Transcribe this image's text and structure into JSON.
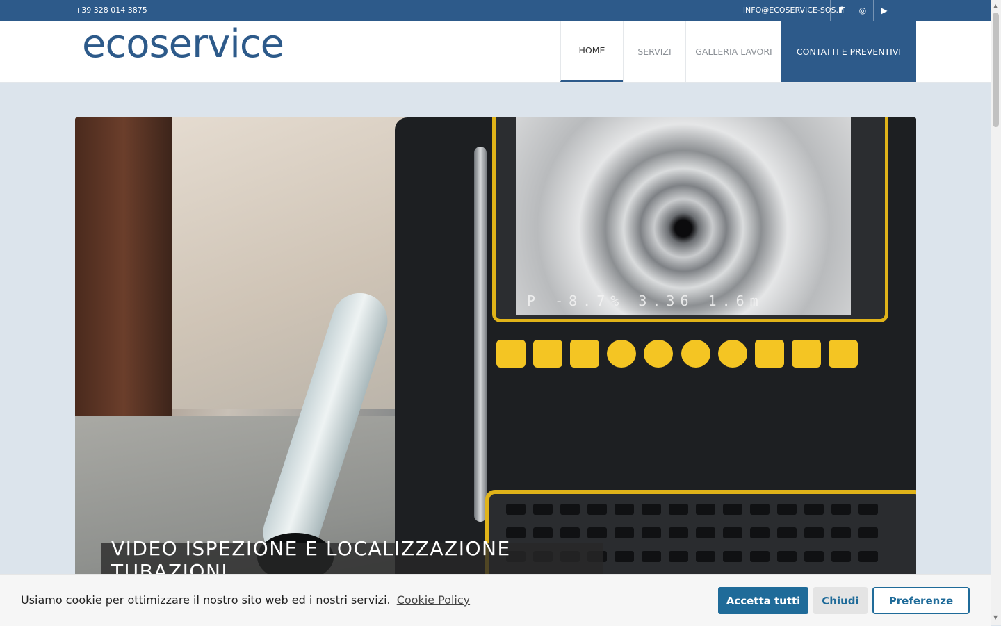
{
  "topbar": {
    "phone": "+39 328 014 3875",
    "email": "INFO@ECOSERVICE-SOS.IT",
    "social": [
      {
        "icon": "facebook-icon",
        "glyph": "f"
      },
      {
        "icon": "instagram-icon",
        "glyph": "◎"
      },
      {
        "icon": "youtube-icon",
        "glyph": "▶"
      }
    ]
  },
  "logo": {
    "text": "ecoservice"
  },
  "nav": {
    "items": [
      {
        "label": "HOME",
        "active": true
      },
      {
        "label": "SERVIZI"
      },
      {
        "label": "GALLERIA LAVORI"
      },
      {
        "label": "CONTATTI E PREVENTIVI",
        "highlight": true
      }
    ]
  },
  "hero": {
    "caption": "VIDEO ISPEZIONE E LOCALIZZAZIONE TUBAZIONI",
    "screen_readout": "P -8.7%  3.36  1.6m"
  },
  "cookie": {
    "message": "Usiamo cookie per ottimizzare il nostro sito web ed i nostri servizi.",
    "policy_link": "Cookie Policy",
    "accept": "Accetta tutti",
    "close": "Chiudi",
    "preferences": "Preferenze"
  },
  "colors": {
    "brand": "#2d5a8a",
    "button": "#1f6b99"
  }
}
